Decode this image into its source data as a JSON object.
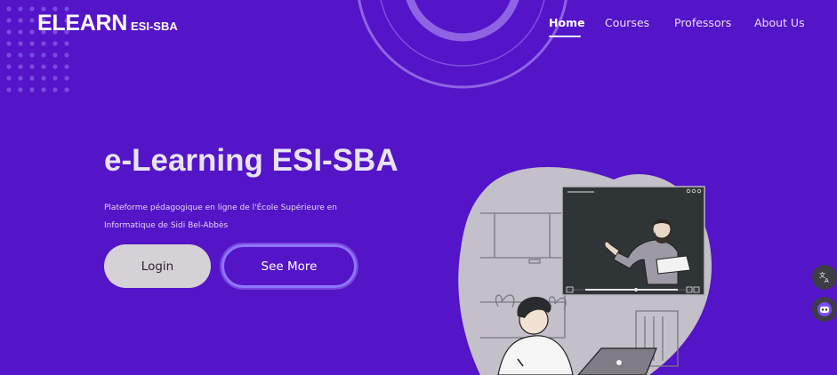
{
  "brand": {
    "name": "ELEARN",
    "suffix": "ESI-SBA"
  },
  "nav": {
    "items": [
      {
        "label": "Home",
        "active": true
      },
      {
        "label": "Courses",
        "active": false
      },
      {
        "label": "Professors",
        "active": false
      },
      {
        "label": "About Us",
        "active": false
      }
    ]
  },
  "hero": {
    "title": "e-Learning ESI-SBA",
    "description": "Plateforme pédagogique en ligne de l'École Supérieure en Informatique de Sidi Bel-Abbès",
    "login_label": "Login",
    "see_more_label": "See More"
  },
  "floating_buttons": {
    "translate_icon": "translate-icon",
    "assistant_icon": "bot-icon"
  },
  "colors": {
    "background": "#5414c8",
    "button_light": "#d6d1d6",
    "button_outline": "#8f76ff",
    "illustration_blob": "#c3c0c9",
    "screen": "#2f3437"
  }
}
